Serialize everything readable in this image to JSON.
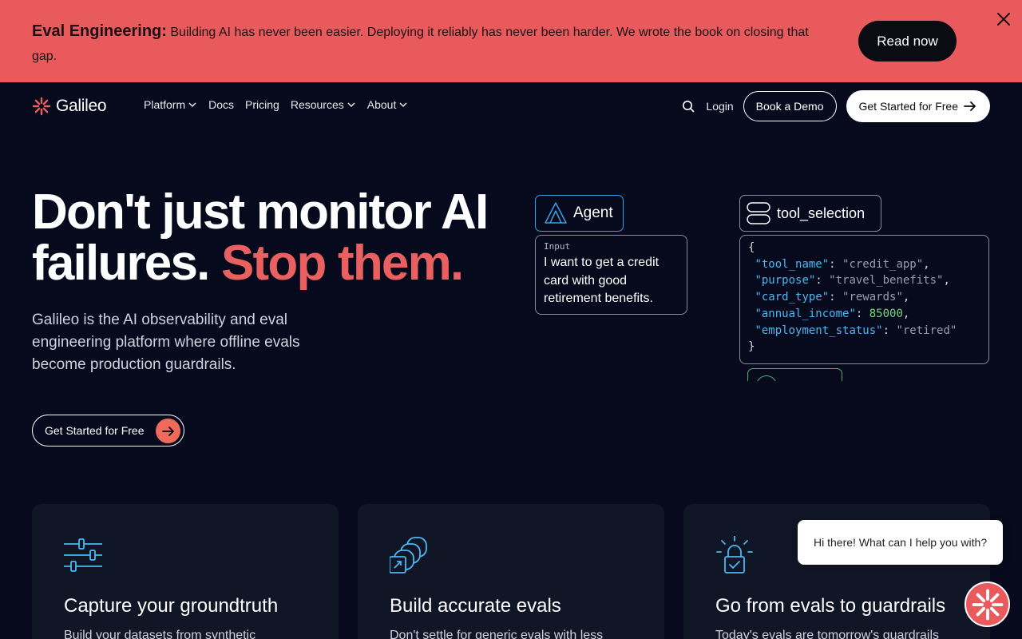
{
  "banner": {
    "title": "Eval Engineering:",
    "text": " Building AI has never been easier. Deploying it reliably has never been harder. We wrote the book on closing that gap.",
    "cta_label": "Read now"
  },
  "nav": {
    "brand": "Galileo",
    "links": [
      {
        "label": "Platform",
        "has_dropdown": true
      },
      {
        "label": "Docs",
        "has_dropdown": false
      },
      {
        "label": "Pricing",
        "has_dropdown": false
      },
      {
        "label": "Resources",
        "has_dropdown": true
      },
      {
        "label": "About",
        "has_dropdown": true
      }
    ],
    "login_label": "Login",
    "demo_label": "Book a Demo",
    "get_started_label": "Get Started for Free"
  },
  "hero": {
    "title_line1": "Don't just monitor AI",
    "title_line2_plain": "failures. ",
    "title_line2_accent": "Stop them.",
    "subtitle": "Galileo is the AI observability and eval engineering platform where offline evals become production guardrails.",
    "cta_label": "Get Started for Free"
  },
  "agent_card": {
    "tag": "Agent",
    "input_label": "Input",
    "input_text": "I want to get a credit card with good retirement benefits."
  },
  "tool_card": {
    "tag": "tool_selection",
    "fields": [
      {
        "key": "\"tool_name\"",
        "value": "\"credit_app\"",
        "type": "string"
      },
      {
        "key": "\"purpose\"",
        "value": "\"travel_benefits\"",
        "type": "string"
      },
      {
        "key": "\"card_type\"",
        "value": "\"rewards\"",
        "type": "string"
      },
      {
        "key": "\"annual_income\"",
        "value": "85000",
        "type": "number"
      },
      {
        "key": "\"employment_status\"",
        "value": "\"retired\"",
        "type": "string"
      }
    ]
  },
  "features": [
    {
      "icon": "sliders-icon",
      "title": "Capture your groundtruth",
      "desc": "Build your datasets from synthetic"
    },
    {
      "icon": "stacked-cards-icon",
      "title": "Build accurate evals",
      "desc": "Don't settle for generic evals with less"
    },
    {
      "icon": "lock-alert-icon",
      "title": "Go from evals to guardrails",
      "desc": "Today's evals are tomorrow's guardrails"
    }
  ],
  "chat": {
    "greeting": "Hi there! What can I help you with?"
  },
  "colors": {
    "banner": "#e85a5c",
    "accent": "#e8605f",
    "background": "#060a1c",
    "card": "#111627",
    "code_key": "#4ab8f2",
    "code_number": "#7ad77a"
  }
}
